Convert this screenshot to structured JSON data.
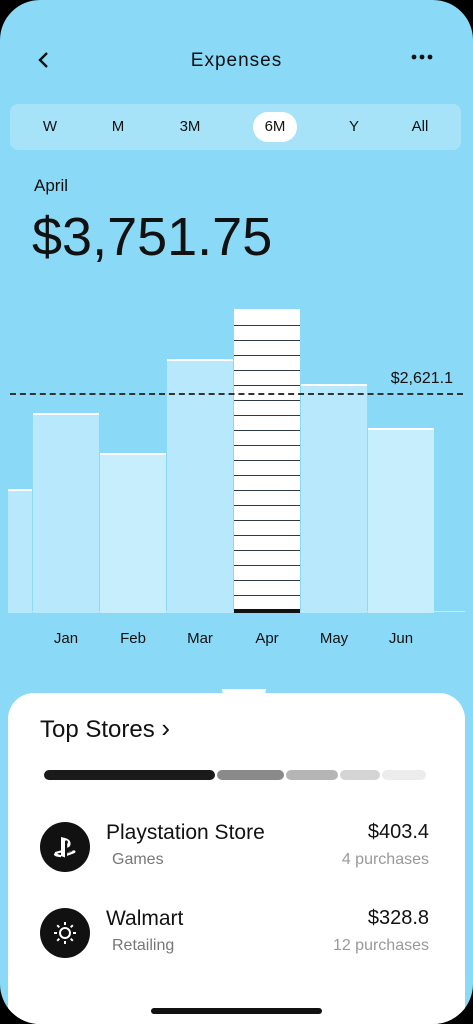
{
  "header": {
    "title": "Expenses"
  },
  "tabs": [
    "W",
    "M",
    "3M",
    "6M",
    "Y",
    "All"
  ],
  "active_tab": "6M",
  "summary": {
    "month": "April",
    "amount": "$3,751.75"
  },
  "chart_data": {
    "type": "bar",
    "categories": [
      "Jan",
      "Feb",
      "Mar",
      "Apr",
      "May",
      "Jun"
    ],
    "values": [
      2960,
      2360,
      3770,
      4520,
      3400,
      2740
    ],
    "partial_previous_value": 1820,
    "average": {
      "label": "$2,621.1"
    },
    "highlighted": "Apr",
    "ylim": [
      0,
      4800
    ]
  },
  "top_stores": {
    "title": "Top Stores",
    "chevron": "›",
    "segment_colors": [
      "#1a1a1a",
      "#8a8a8a",
      "#b5b5b5",
      "#d4d4d4",
      "#ececec"
    ],
    "segment_shares": [
      0.45,
      0.18,
      0.14,
      0.11,
      0.12
    ],
    "items": [
      {
        "name": "Playstation Store",
        "category": "Games",
        "amount": "$403.4",
        "count": "4 purchases",
        "icon": "playstation-icon"
      },
      {
        "name": "Walmart",
        "category": "Retailing",
        "amount": "$328.8",
        "count": "12 purchases",
        "icon": "walmart-icon"
      }
    ]
  }
}
